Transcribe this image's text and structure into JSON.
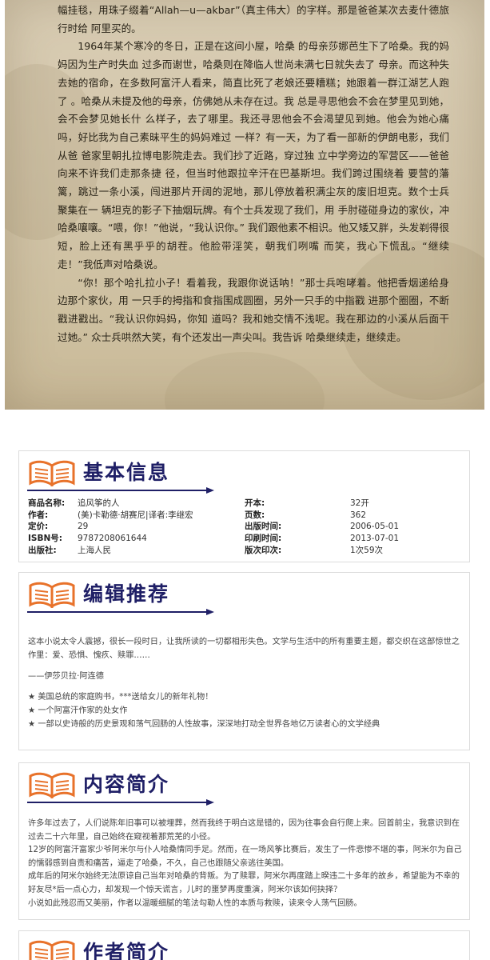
{
  "excerpt": {
    "paragraphs": [
      {
        "indent": false,
        "text": "幅挂毯，用珠子缀着“Allah—u—akbar”（真主伟大）的字样。那是爸爸某次去麦什德旅行时给 阿里买的。"
      },
      {
        "indent": true,
        "text": "1964年某个寒冷的冬日，正是在这间小屋，哈桑 的母亲莎娜芭生下了哈桑。我的妈妈因为生产时失血 过多而谢世，哈桑则在降临人世尚未满七日就失去了 母亲。而这种失去她的宿命，在多数阿富汗人看来，简直比死了老娘还要糟糕；她跟着一群江湖艺人跑了 。哈桑从未提及他的母亲，仿佛她从未存在过。我 总是寻思他会不会在梦里见到她，会不会梦见她长什 么样子，去了哪里。我还寻思他会不会渴望见到她。他会为她心痛吗，好比我为自己素昧平生的妈妈难过 一样？有一天，为了看一部新的伊朗电影，我们从爸 爸家里朝扎拉博电影院走去。我们抄了近路，穿过独 立中学旁边的军营区——爸爸向来不许我们走那条捷 径，但当时他跟拉辛汗在巴基斯坦。我们跨过围绕着 要营的藩篱，跳过一条小溪，闯进那片开阔的泥地，那儿停放着积满尘灰的废旧坦克。数个士兵聚集在一 辆坦克的影子下抽烟玩牌。有个士兵发现了我们，用 手肘碰碰身边的家伙，冲哈桑嚷嚷。“喂，你！”他说，“我认识你。” 我们跟他素不相识。他又矮又胖，头发剃得很短，脸上还有黑乎乎的胡茬。他脸带淫笑，朝我们咧嘴 而笑，我心下慌乱。“继续走！”我低声对哈桑说。"
      },
      {
        "indent": true,
        "text": "“你！那个哈扎拉小子！看着我，我跟你说话呐！”那士兵咆哮着。他把香烟递给身边那个家伙，用 一只手的拇指和食指围成圆圈，另外一只手的中指戳 进那个圈圈，不断戳进戳出。“我认识你妈妈，你知 道吗？我和她交情不浅呢。我在那边的小溪从后面干 过她。” 众士兵哄然大笑，有个还发出一声尖叫。我告诉 哈桑继续走，继续走。"
      }
    ]
  },
  "basic_info": {
    "title": "基本信息",
    "rows": [
      {
        "k1": "商品名称:",
        "v1": "追风筝的人",
        "k2": "开本:",
        "v2": "32开"
      },
      {
        "k1": "作者:",
        "v1": "(美)卡勒德·胡赛尼|译者:李继宏",
        "k2": "页数:",
        "v2": "362"
      },
      {
        "k1": "定价:",
        "v1": "29",
        "k2": "出版时间:",
        "v2": "2006-05-01"
      },
      {
        "k1": "ISBN号:",
        "v1": "9787208061644",
        "k2": "印刷时间:",
        "v2": "2013-07-01"
      },
      {
        "k1": "出版社:",
        "v1": "上海人民",
        "k2": "版次印次:",
        "v2": "1次59次"
      }
    ]
  },
  "editor_recommend": {
    "title": "编辑推荐",
    "lines": [
      "这本小说太令人震撼，很长一段时日，让我所读的一切都相形失色。文学与生活中的所有重要主题，都交织在这部惊世之作里：爱、恐惧、愧疚、赎罪……",
      "——伊莎贝拉·阿连德",
      "★ 美国总统的家庭购书，***送给女儿的新年礼物！",
      "★ 一个阿富汗作家的处女作",
      "★ 一部以史诗般的历史景观和荡气回肠的人性故事，深深地打动全世界各地亿万读者心的文学经典"
    ]
  },
  "content_summary": {
    "title": "内容简介",
    "lines": [
      "许多年过去了，人们说陈年旧事可以被埋葬，然而我终于明白这是错的，因为往事会自行爬上来。回首前尘，我意识到在过去二十六年里，自己始终在窥视着那荒芜的小径。",
      "12岁的阿富汗富家少爷阿米尔与仆人哈桑情同手足。然而，在一场风筝比赛后，发生了一件悲惨不堪的事，阿米尔为自己的懦弱感到自责和痛苦，逼走了哈桑，不久，自己也跟随父亲逃往美国。",
      "成年后的阿米尔始终无法原谅自己当年对哈桑的背叛。为了赎罪，阿米尔再度踏上暌违二十多年的故乡，希望能为不幸的好友尽*后一点心力，却发现一个惊天谎言，儿时的噩梦再度重演，阿米尔该如何抉择？",
      "小说如此残忍而又美丽，作者以温暖细腻的笔法勾勒人性的本质与救赎，读来令人荡气回肠。"
    ]
  },
  "author_intro": {
    "title": "作者简介"
  },
  "colors": {
    "title_navy": "#1f1f66",
    "icon_orange": "#e8722a",
    "parchment": "#d3c6ab"
  },
  "icons": [
    "open-book-icon",
    "arrow-line-icon"
  ]
}
